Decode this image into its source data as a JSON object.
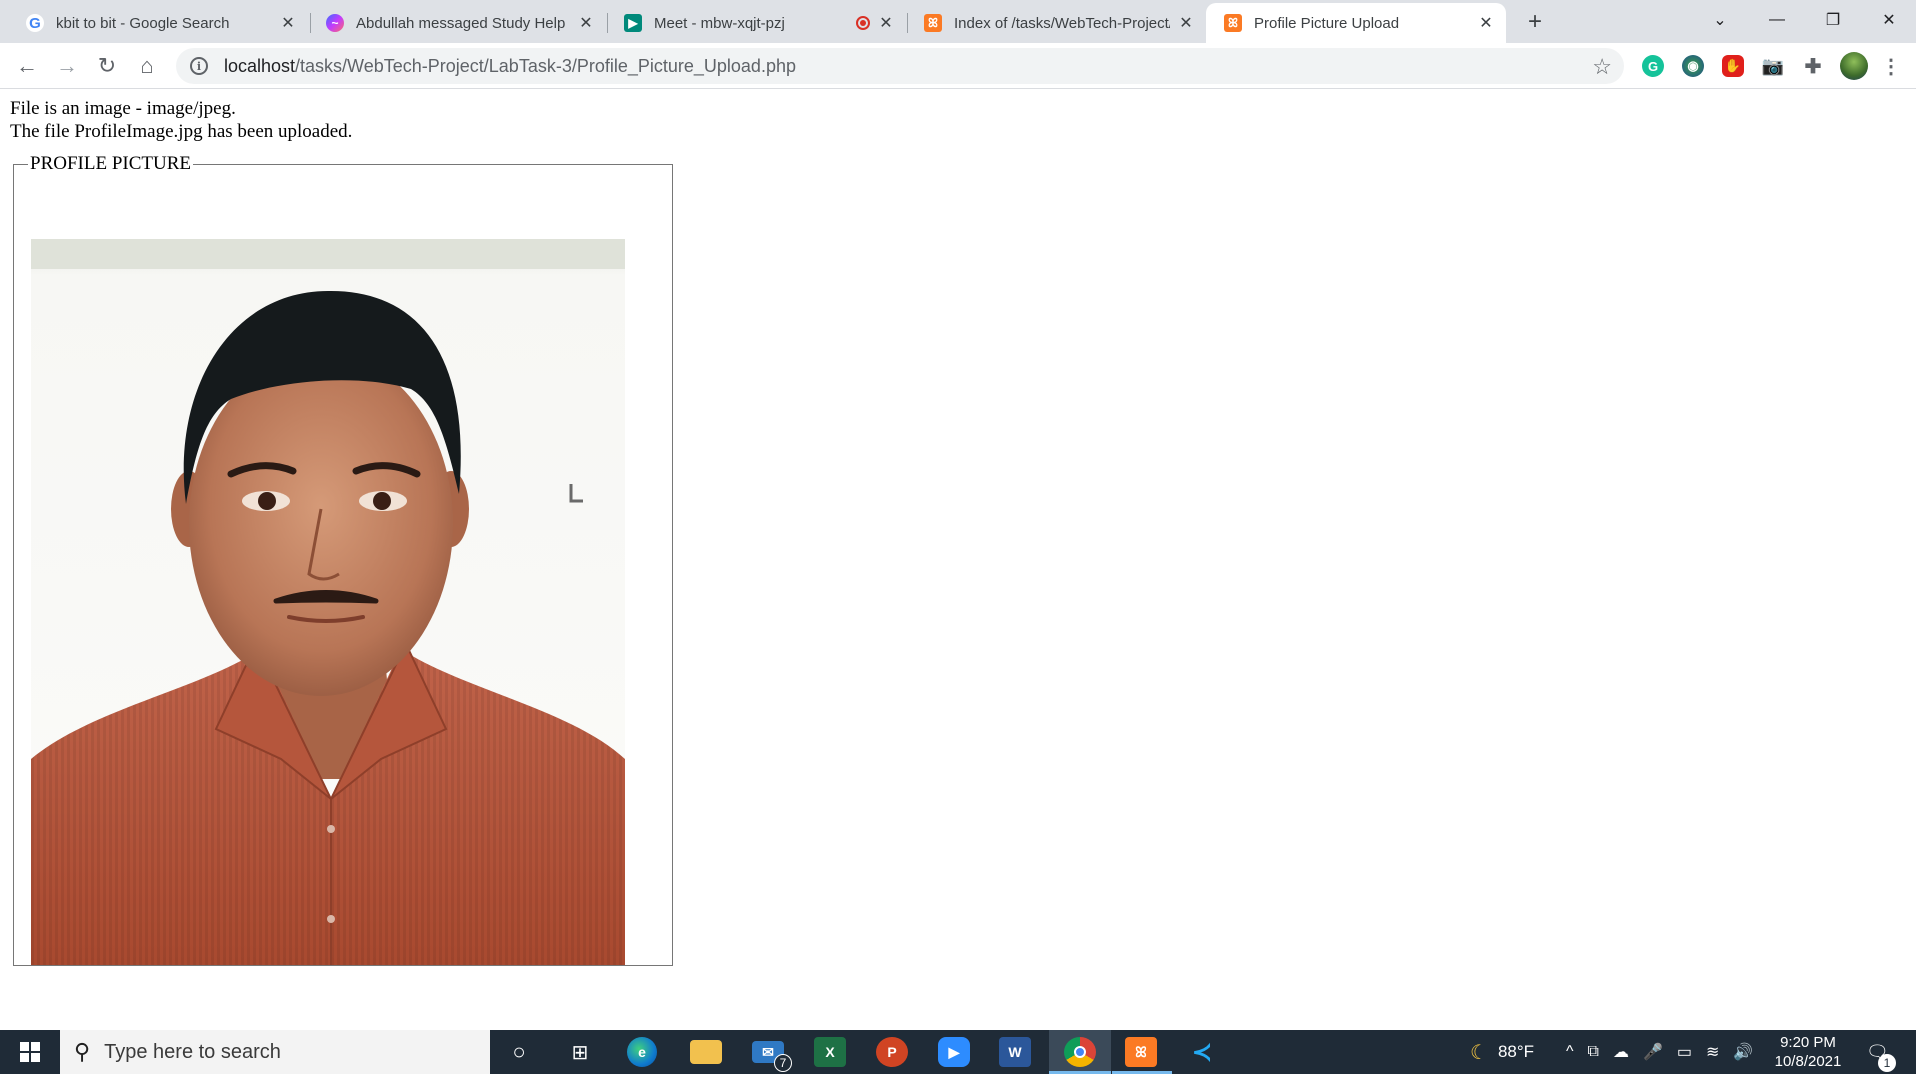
{
  "browser": {
    "tabs": [
      {
        "title": "kbit to bit - Google Search",
        "icon": "google-icon",
        "active": false
      },
      {
        "title": "Abdullah messaged Study Help [",
        "icon": "messenger-icon",
        "active": false
      },
      {
        "title": "Meet - mbw-xqjt-pzj",
        "icon": "google-meet-icon",
        "active": false,
        "recording": true
      },
      {
        "title": "Index of /tasks/WebTech-Project/",
        "icon": "xampp-icon",
        "active": false
      },
      {
        "title": "Profile Picture Upload",
        "icon": "xampp-icon",
        "active": true
      }
    ],
    "new_tab": "+",
    "address": {
      "host": "localhost",
      "path": "/tasks/WebTech-Project/LabTask-3/Profile_Picture_Upload.php"
    },
    "extensions": [
      "grammarly-icon",
      "earth-extension-icon",
      "adblock-icon",
      "camera-icon",
      "puzzle-icon",
      "profile-avatar"
    ]
  },
  "page": {
    "message_1": "File is an image - image/jpeg.",
    "message_2": "The file ProfileImage.jpg has been uploaded.",
    "legend": "PROFILE PICTURE",
    "image_alt": "Profile photo"
  },
  "taskbar": {
    "search_placeholder": "Type here to search",
    "apps": [
      "cortana-icon",
      "task-view-icon",
      "edge-icon",
      "file-explorer-icon",
      "mail-icon",
      "excel-icon",
      "powerpoint-icon",
      "zoom-icon",
      "word-icon",
      "chrome-icon",
      "xampp-icon",
      "vscode-icon"
    ],
    "mail_badge": "7",
    "weather": "88°F",
    "time": "9:20 PM",
    "date": "10/8/2021",
    "notification_count": "1"
  },
  "colors": {
    "tabstrip": "#dee1e6",
    "taskbar": "#1f2b37",
    "shirt": "#b8593f"
  }
}
